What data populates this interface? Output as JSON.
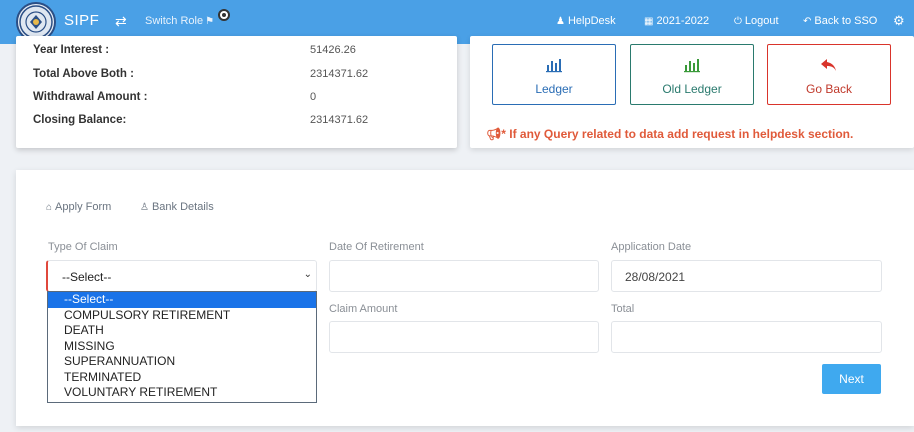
{
  "navbar": {
    "brand": "SIPF",
    "switch_role": "Switch Role",
    "helpdesk": "HelpDesk",
    "year": "2021-2022",
    "logout": "Logout",
    "back_to_sso": "Back to SSO",
    "icons": {
      "swap": "exchange-icon",
      "user": "user-icon",
      "calendar": "calendar-icon",
      "power": "power-icon",
      "back": "reply-icon",
      "gear": "gear-icon",
      "flag": "flag-icon"
    }
  },
  "summary": {
    "rows": [
      {
        "label": "Year Interest :",
        "value": "51426.26"
      },
      {
        "label": "Total Above Both :",
        "value": "2314371.62"
      },
      {
        "label": "Withdrawal Amount :",
        "value": "0"
      },
      {
        "label": "Closing Balance:",
        "value": "2314371.62"
      }
    ]
  },
  "actions": {
    "ledger": "Ledger",
    "old_ledger": "Old Ledger",
    "go_back": "Go Back",
    "notice": "* If any Query related to data add request in helpdesk section."
  },
  "form": {
    "tabs": {
      "apply_form": "Apply Form",
      "bank_details": "Bank Details"
    },
    "type_of_claim_label": "Type Of Claim",
    "type_of_claim_value": "--Select--",
    "date_of_retirement_label": "Date Of Retirement",
    "date_of_retirement_value": "",
    "application_date_label": "Application Date",
    "application_date_value": "28/08/2021",
    "claim_amount_label": "Claim Amount",
    "claim_amount_value": "",
    "total_label": "Total",
    "total_value": "",
    "claim_options": [
      "--Select--",
      "COMPULSORY RETIREMENT",
      "DEATH",
      "MISSING",
      "SUPERANNUATION",
      "TERMINATED",
      "VOLUNTARY RETIREMENT"
    ],
    "selected_option": "--Select--",
    "next": "Next"
  },
  "colors": {
    "navbar": "#4aa0e6",
    "ledger": "#2a6db5",
    "old_ledger": "#2a7a6e",
    "go_back": "#d9342b",
    "notice": "#e05a3a",
    "next": "#3fa9ef",
    "selected_option": "#1a73e8"
  }
}
